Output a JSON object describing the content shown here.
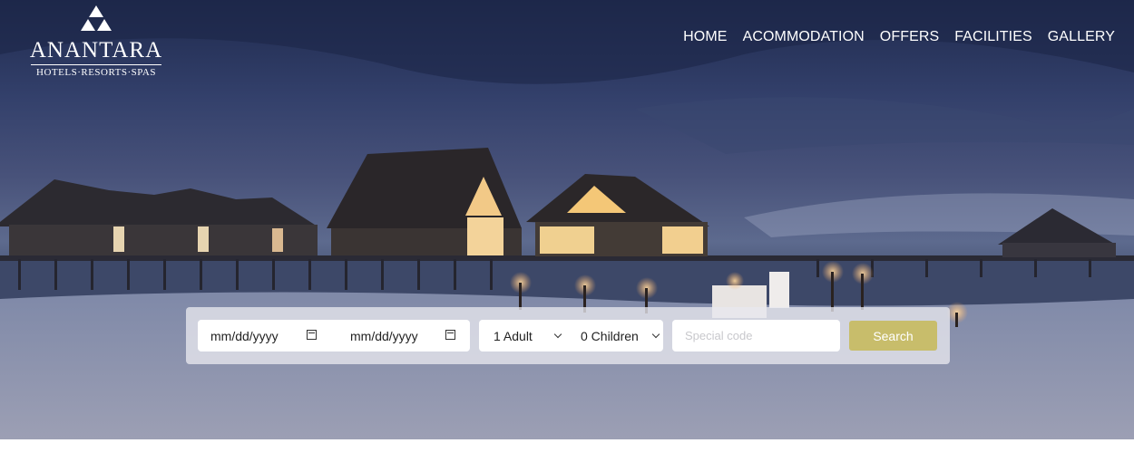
{
  "brand": {
    "name": "ANANTARA",
    "tagline": "HOTELS·RESORTS·SPAS"
  },
  "nav": {
    "items": [
      "HOME",
      "ACOMMODATION",
      "OFFERS",
      "FACILITIES",
      "GALLERY"
    ]
  },
  "booking": {
    "checkin_placeholder": "mm/dd/yyyy",
    "checkout_placeholder": "mm/dd/yyyy",
    "adults": "1 Adult",
    "children": "0 Children",
    "code_placeholder": "Special code",
    "search_label": "Search"
  },
  "colors": {
    "accent": "#c8bd6b"
  },
  "icons": {
    "date": "calendar-icon",
    "select": "chevron-down-icon",
    "logo": "anantara-logo-icon"
  }
}
